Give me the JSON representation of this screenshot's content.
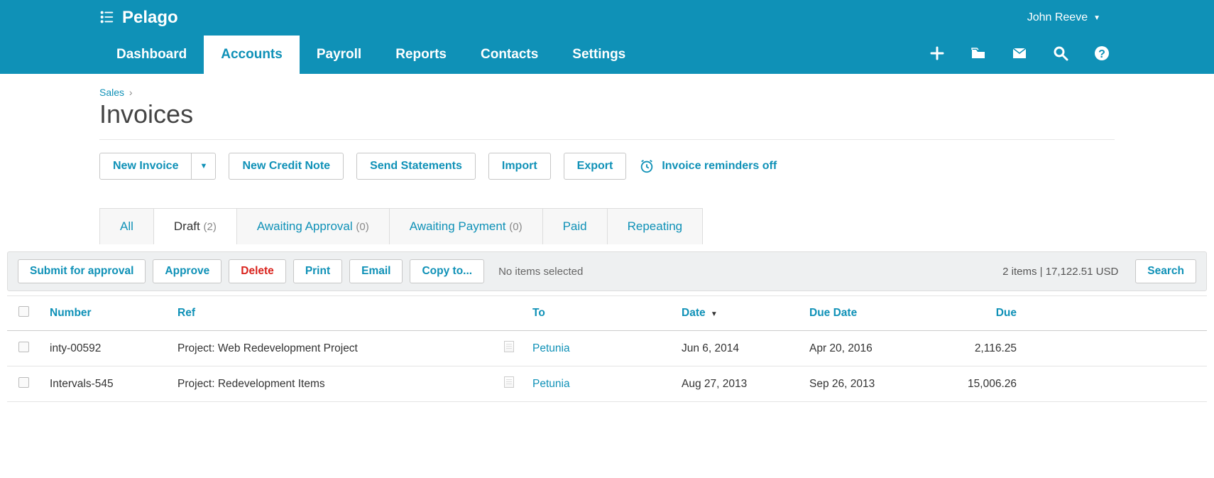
{
  "app_name": "Pelago",
  "user_name": "John Reeve",
  "nav": [
    "Dashboard",
    "Accounts",
    "Payroll",
    "Reports",
    "Contacts",
    "Settings"
  ],
  "nav_active_index": 1,
  "breadcrumb": {
    "parent": "Sales",
    "sep": "›"
  },
  "page_title": "Invoices",
  "actions": {
    "new_invoice": "New Invoice",
    "new_credit_note": "New Credit Note",
    "send_statements": "Send Statements",
    "import": "Import",
    "export": "Export",
    "reminders": "Invoice reminders off"
  },
  "subtabs": [
    {
      "label": "All",
      "count": null
    },
    {
      "label": "Draft",
      "count": "(2)"
    },
    {
      "label": "Awaiting Approval",
      "count": "(0)"
    },
    {
      "label": "Awaiting Payment",
      "count": "(0)"
    },
    {
      "label": "Paid",
      "count": null
    },
    {
      "label": "Repeating",
      "count": null
    }
  ],
  "subtab_active_index": 1,
  "toolbar": {
    "submit": "Submit for approval",
    "approve": "Approve",
    "delete": "Delete",
    "print": "Print",
    "email": "Email",
    "copy": "Copy to...",
    "status": "No items selected",
    "summary": "2 items  |  17,122.51  USD",
    "search": "Search"
  },
  "columns": {
    "number": "Number",
    "ref": "Ref",
    "to": "To",
    "date": "Date",
    "due_date": "Due Date",
    "due": "Due"
  },
  "rows": [
    {
      "number": "inty-00592",
      "ref": "Project: Web Redevelopment Project",
      "to": "Petunia",
      "date": "Jun 6, 2014",
      "due_date": "Apr 20, 2016",
      "due": "2,116.25"
    },
    {
      "number": "Intervals-545",
      "ref": "Project: Redevelopment Items",
      "to": "Petunia",
      "date": "Aug 27, 2013",
      "due_date": "Sep 26, 2013",
      "due": "15,006.26"
    }
  ]
}
